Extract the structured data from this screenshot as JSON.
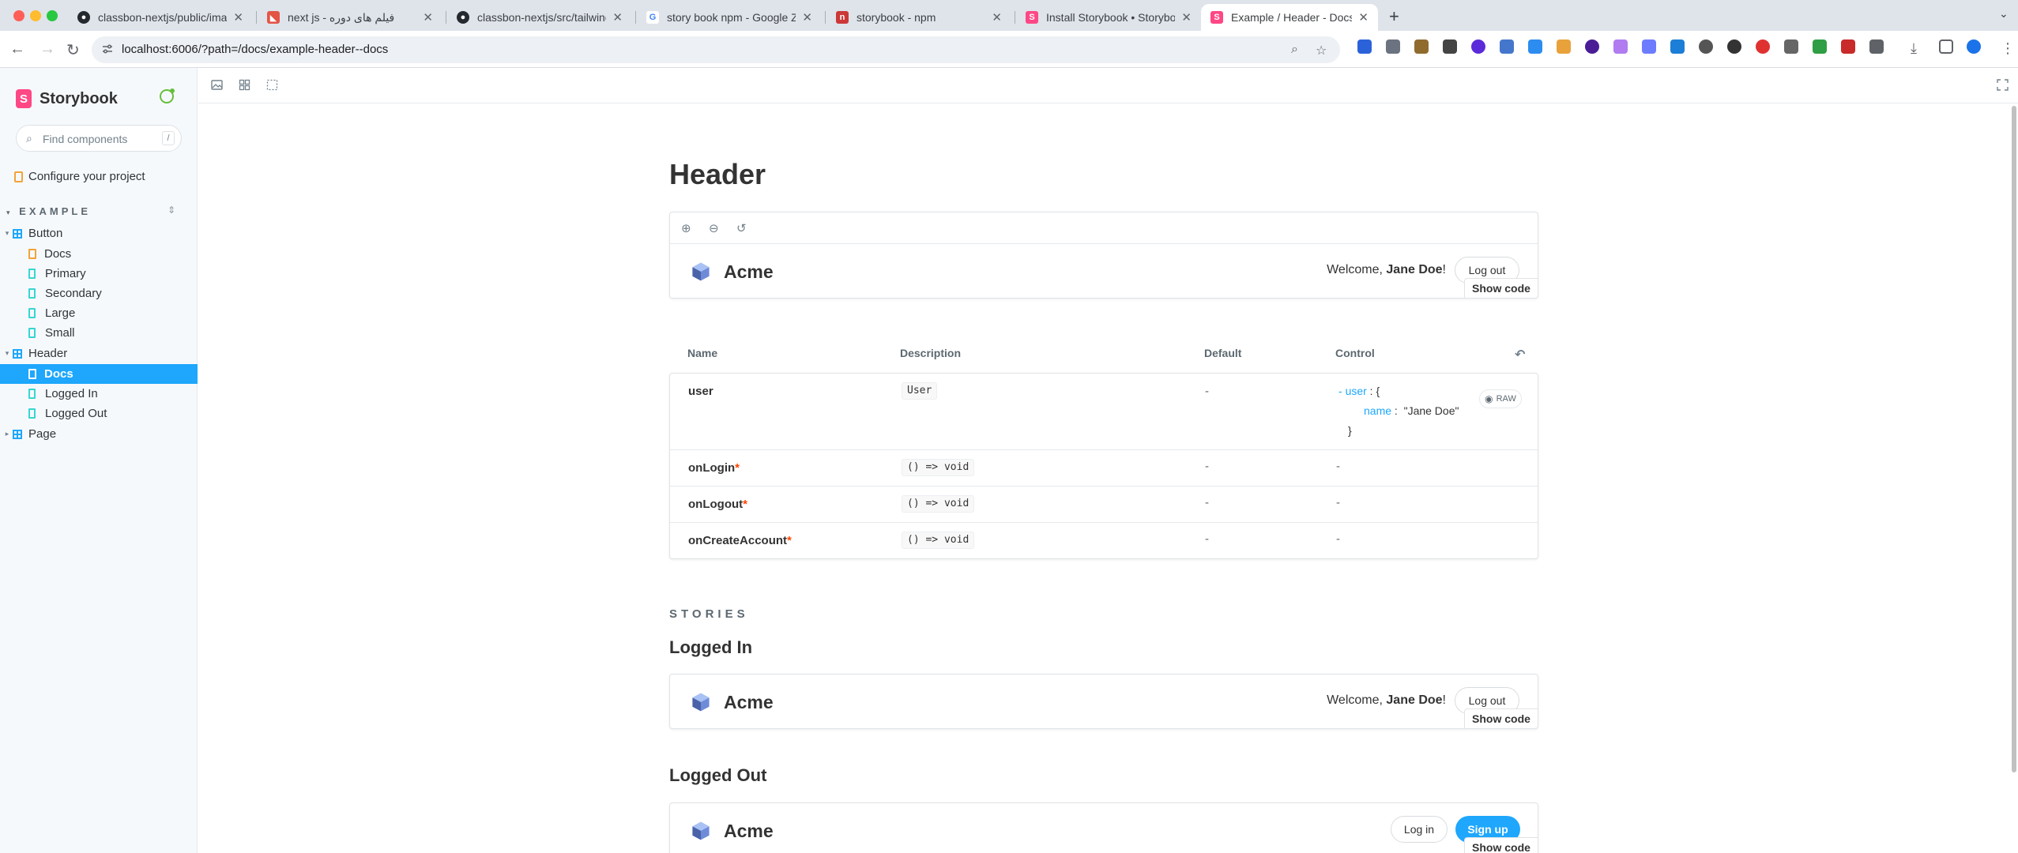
{
  "browser": {
    "tabs": [
      {
        "title": "classbon-nextjs/public/images",
        "favicon": "github",
        "active": false
      },
      {
        "title": "next js - فیلم های دوره",
        "favicon": "red",
        "active": false
      },
      {
        "title": "classbon-nextjs/src/tailwind/t",
        "favicon": "github",
        "active": false
      },
      {
        "title": "story book npm - Google Zoo",
        "favicon": "google",
        "active": false
      },
      {
        "title": "storybook - npm",
        "favicon": "npm",
        "active": false
      },
      {
        "title": "Install Storybook • Storybook",
        "favicon": "storybook",
        "active": false
      },
      {
        "title": "Example / Header - Docs • St",
        "favicon": "storybook",
        "active": true
      }
    ],
    "url": "localhost:6006/?path=/docs/example-header--docs"
  },
  "sidebar": {
    "brand": "Storybook",
    "search_placeholder": "Find components",
    "search_shortcut": "/",
    "configure_label": "Configure your project",
    "section": "EXAMPLE",
    "items": [
      {
        "label": "Button",
        "kind": "component"
      },
      {
        "label": "Docs",
        "kind": "docs"
      },
      {
        "label": "Primary",
        "kind": "story"
      },
      {
        "label": "Secondary",
        "kind": "story"
      },
      {
        "label": "Large",
        "kind": "story"
      },
      {
        "label": "Small",
        "kind": "story"
      },
      {
        "label": "Header",
        "kind": "component"
      },
      {
        "label": "Docs",
        "kind": "docs",
        "selected": true
      },
      {
        "label": "Logged In",
        "kind": "story"
      },
      {
        "label": "Logged Out",
        "kind": "story"
      },
      {
        "label": "Page",
        "kind": "component"
      }
    ]
  },
  "docs": {
    "title": "Header",
    "brand": "Acme",
    "welcome_prefix": "Welcome,",
    "user_name": "Jane Doe",
    "welcome_suffix": "!",
    "logout": "Log out",
    "login": "Log in",
    "signup": "Sign up",
    "show_code": "Show code",
    "stories_heading": "STORIES",
    "story_logged_in": "Logged In",
    "story_logged_out": "Logged Out"
  },
  "args_table": {
    "headers": {
      "name": "Name",
      "description": "Description",
      "default": "Default",
      "control": "Control"
    },
    "rows": [
      {
        "name": "user",
        "type": "User",
        "default": "-",
        "required": false
      },
      {
        "name": "onLogin",
        "type": "() => void",
        "default": "-",
        "control": "-",
        "required": true
      },
      {
        "name": "onLogout",
        "type": "() => void",
        "default": "-",
        "control": "-",
        "required": true
      },
      {
        "name": "onCreateAccount",
        "type": "() => void",
        "default": "-",
        "control": "-",
        "required": true
      }
    ],
    "user_control": {
      "dash": "-",
      "key": "user",
      "open": "{",
      "field_key": "name",
      "field_value": "\"Jane Doe\"",
      "close": "}",
      "raw": "RAW"
    },
    "required_mark": "*"
  },
  "colors": {
    "accent": "#1ea7fd",
    "brand": "#ff4785",
    "required": "#ff4400"
  }
}
